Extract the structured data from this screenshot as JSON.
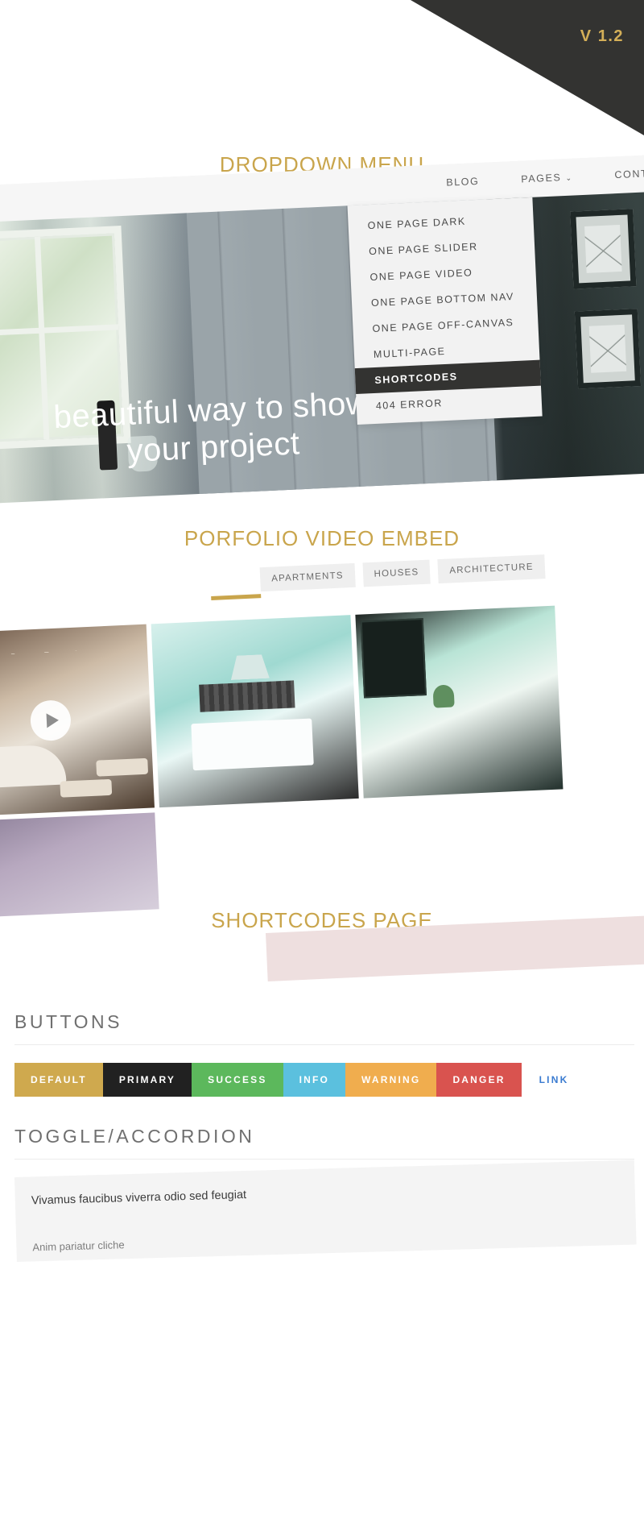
{
  "version_badge": "V 1.2",
  "sections": {
    "dropdown_title": "DROPDOWN MENU",
    "portfolio_title": "PORFOLIO VIDEO EMBED",
    "shortcodes_title": "SHORTCODES PAGE"
  },
  "nav": {
    "items": [
      {
        "label": "BLOG",
        "has_caret": false
      },
      {
        "label": "PAGES",
        "has_caret": true
      },
      {
        "label": "CONTACT",
        "has_caret": false
      }
    ],
    "caret_glyph": "⌄"
  },
  "dropdown": {
    "items": [
      {
        "label": "ONE PAGE DARK",
        "active": false
      },
      {
        "label": "ONE PAGE SLIDER",
        "active": false
      },
      {
        "label": "ONE PAGE VIDEO",
        "active": false
      },
      {
        "label": "ONE PAGE BOTTOM NAV",
        "active": false
      },
      {
        "label": "ONE PAGE OFF-CANVAS",
        "active": false
      },
      {
        "label": "MULTI-PAGE",
        "active": false
      },
      {
        "label": "SHORTCODES",
        "active": true
      },
      {
        "label": "404 ERROR",
        "active": false
      }
    ]
  },
  "hero": {
    "caption_line1": "beautiful way to show",
    "caption_line2": "your project"
  },
  "portfolio": {
    "filters": [
      {
        "label": "APARTMENTS"
      },
      {
        "label": "HOUSES"
      },
      {
        "label": "ARCHITECTURE"
      }
    ],
    "play_icon": "play-icon"
  },
  "shortcodes": {
    "buttons_heading": "BUTTONS",
    "buttons": [
      {
        "label": "DEFAULT",
        "bg": "#cfa94e",
        "fg": "#ffffff"
      },
      {
        "label": "PRIMARY",
        "bg": "#212121",
        "fg": "#ffffff"
      },
      {
        "label": "SUCCESS",
        "bg": "#5cb85c",
        "fg": "#ffffff"
      },
      {
        "label": "INFO",
        "bg": "#5bc0de",
        "fg": "#ffffff"
      },
      {
        "label": "WARNING",
        "bg": "#f0ad4e",
        "fg": "#ffffff"
      },
      {
        "label": "DANGER",
        "bg": "#d9534f",
        "fg": "#ffffff"
      },
      {
        "label": "LINK",
        "bg": "transparent",
        "fg": "#3a7bd0"
      }
    ],
    "toggle_heading": "TOGGLE/ACCORDION",
    "accordion": {
      "title": "Vivamus faucibus viverra odio sed feugiat",
      "body": "Anim pariatur cliche"
    }
  },
  "colors": {
    "accent_gold": "#c9a54c",
    "dark": "#333331",
    "badge_gold": "#d4af58",
    "pink_band": "#eedfdf"
  }
}
